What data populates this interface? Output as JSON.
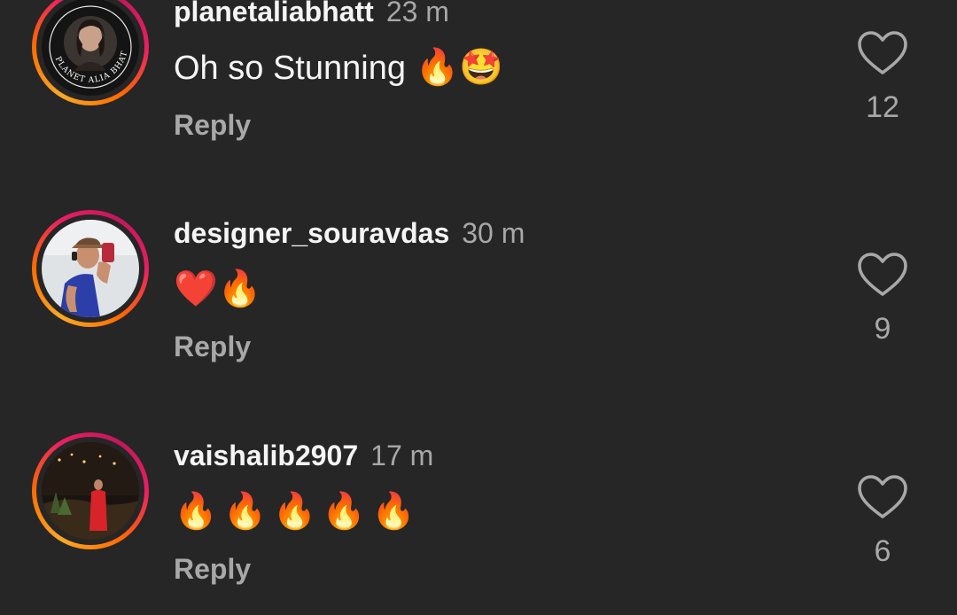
{
  "comments": [
    {
      "username": "planetaliabhatt",
      "time": "23 m",
      "text": "Oh so Stunning",
      "emojis": "🔥🤩",
      "reply_label": "Reply",
      "likes": "12",
      "avatar_text": "PLANET ALIA BHATT"
    },
    {
      "username": "designer_souravdas",
      "time": "30 m",
      "text": "",
      "emojis": "❤️🔥",
      "reply_label": "Reply",
      "likes": "9"
    },
    {
      "username": "vaishalib2907",
      "time": "17 m",
      "text": "",
      "emojis": "🔥🔥🔥🔥🔥",
      "reply_label": "Reply",
      "likes": "6"
    }
  ],
  "colors": {
    "background": "#262626",
    "primary_text": "#f5f5f5",
    "secondary_text": "#a8a8a8",
    "story_ring_start": "#f9a825",
    "story_ring_end": "#e91e63"
  },
  "icons": {
    "like": "heart-outline-icon"
  }
}
